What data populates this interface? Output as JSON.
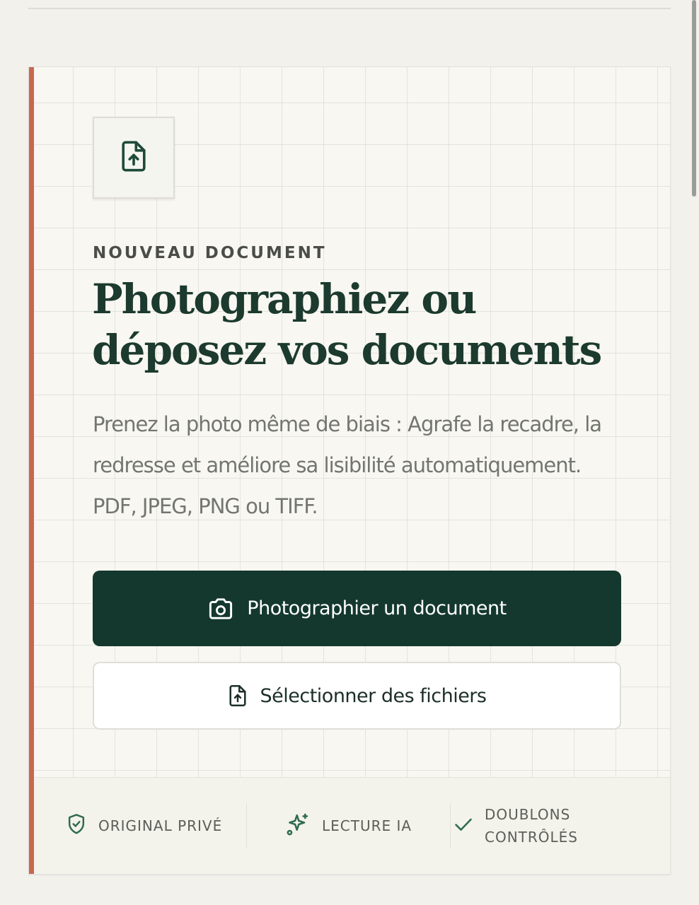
{
  "colors": {
    "brand": "#14382d",
    "accent": "#c8674f",
    "heading": "#1c3a2e",
    "background": "#f8f7f2"
  },
  "card": {
    "upload_tile_icon": "file-upload-icon",
    "eyebrow": "NOUVEAU DOCUMENT",
    "title_line1": "Photographiez ou",
    "title_line2": "déposez vos documents",
    "description": "Prenez la photo même de biais : Agrafe la recadre, la redresse et améliore sa lisibilité automatiquement. PDF, JPEG, PNG ou TIFF."
  },
  "actions": {
    "primary": {
      "label": "Photographier un document",
      "icon": "camera-icon"
    },
    "secondary": {
      "label": "Sélectionner des fichiers",
      "icon": "file-upload-icon"
    }
  },
  "features": [
    {
      "icon": "shield-check-icon",
      "label": "ORIGINAL PRIVÉ"
    },
    {
      "icon": "sparkles-icon",
      "label": "LECTURE IA"
    },
    {
      "icon": "check-icon",
      "label_line1": "DOUBLONS",
      "label_line2": "CONTRÔLÉS"
    }
  ]
}
